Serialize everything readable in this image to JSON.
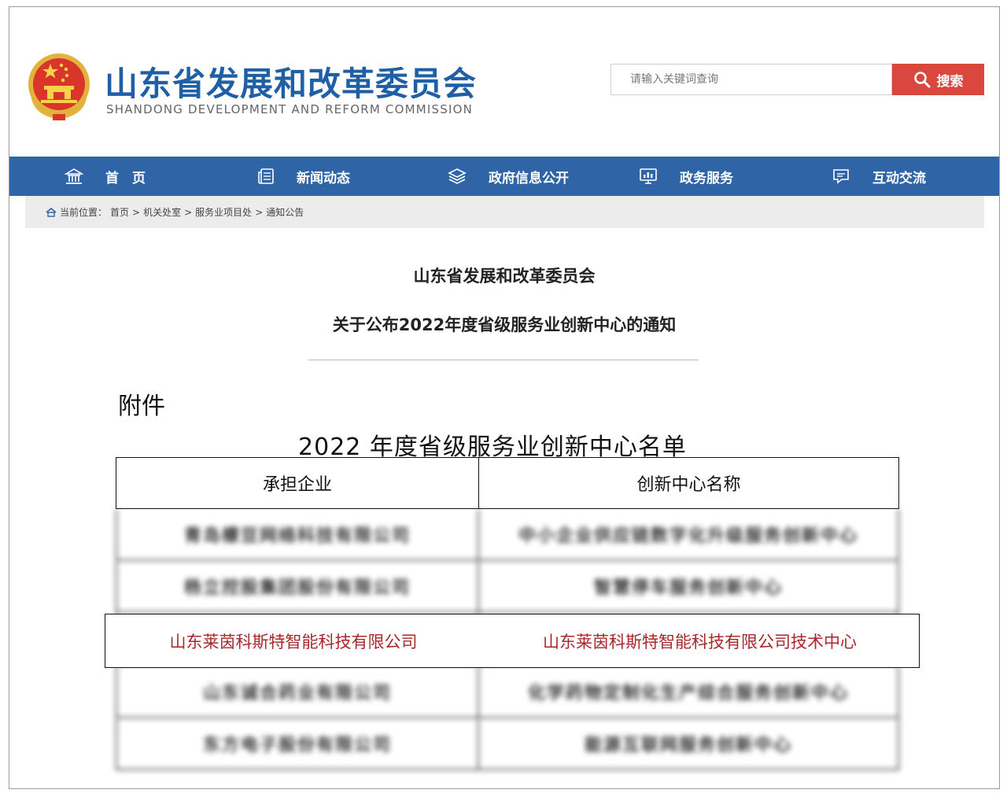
{
  "header": {
    "site_title": "山东省发展和改革委员会",
    "site_subtitle": "SHANDONG DEVELOPMENT AND REFORM COMMISSION",
    "search_placeholder": "请输入关键词查询",
    "search_button": "搜索"
  },
  "nav": {
    "items": [
      {
        "label": "首　页",
        "icon": "home-icon"
      },
      {
        "label": "新闻动态",
        "icon": "news-icon"
      },
      {
        "label": "政府信息公开",
        "icon": "layers-icon"
      },
      {
        "label": "政务服务",
        "icon": "monitor-chart-icon"
      },
      {
        "label": "互动交流",
        "icon": "chat-icon"
      }
    ]
  },
  "breadcrumb": {
    "prefix": "当前位置：",
    "items": [
      "首页",
      "机关处室",
      "服务业项目处",
      "通知公告"
    ],
    "separator": ">"
  },
  "article": {
    "title_line1": "山东省发展和改革委员会",
    "title_line2": "关于公布2022年度省级服务业创新中心的通知",
    "attachment_label": "附件",
    "list_title": "2022 年度省级服务业创新中心名单"
  },
  "table": {
    "headers": [
      "承担企业",
      "创新中心名称"
    ],
    "rows": [
      {
        "company": "青岛檬豆网络科技有限公司",
        "center": "中小企业供应链数字化升级服务创新中心",
        "blurred": true
      },
      {
        "company": "杨立控股集团股份有限公司",
        "center": "智慧停车服务创新中心",
        "blurred": true
      },
      {
        "company": "山东莱茵科斯特智能科技有限公司",
        "center": "山东莱茵科斯特智能科技有限公司技术中心",
        "blurred": false
      },
      {
        "company": "山东诚合药业有限公司",
        "center": "化学药物定制化生产综合服务创新中心",
        "blurred": true
      },
      {
        "company": "东方电子股份有限公司",
        "center": "能源互联网服务创新中心",
        "blurred": true
      }
    ]
  },
  "colors": {
    "brand_blue": "#1f5fa6",
    "nav_blue": "#2f65a6",
    "search_red": "#d9473f",
    "highlight_red": "#a8282c"
  }
}
